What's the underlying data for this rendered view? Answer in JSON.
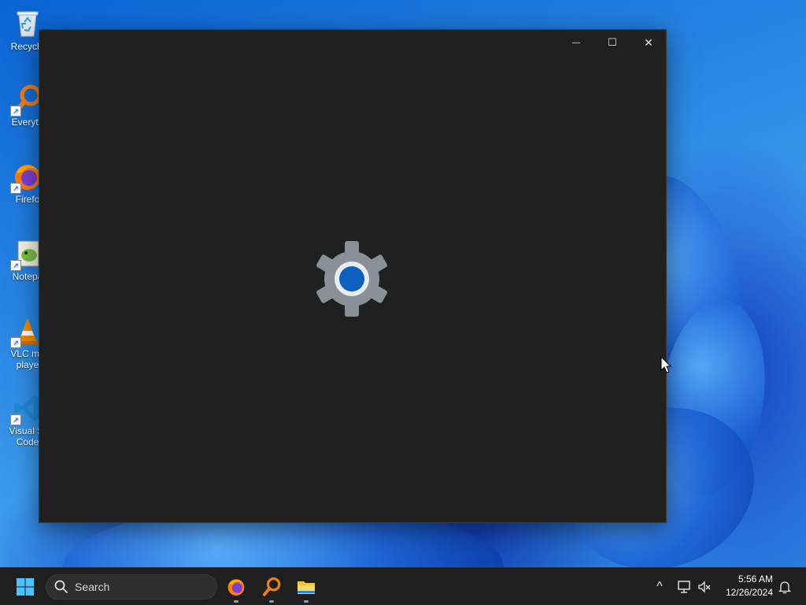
{
  "desktop": {
    "icons": [
      {
        "label": "Recycle"
      },
      {
        "label": "Everyth"
      },
      {
        "label": "Firefo"
      },
      {
        "label": "Notepa"
      },
      {
        "label": "VLC me playe"
      },
      {
        "label": "Visual St Code"
      }
    ]
  },
  "settings_window": {
    "minimize_symbol": "—",
    "maximize_symbol": "☐",
    "close_symbol": "✕",
    "splash_icon": "settings-gear-icon"
  },
  "taskbar": {
    "search": {
      "placeholder": "Search"
    },
    "pinned_apps": [
      {
        "name": "firefox-icon"
      },
      {
        "name": "everything-search-icon"
      },
      {
        "name": "file-explorer-icon"
      }
    ],
    "tray": {
      "overflow_symbol": "^",
      "clock": {
        "time": "5:56 AM",
        "date": "12/26/2024"
      }
    }
  },
  "colors": {
    "window_bg": "#202020",
    "taskbar_bg": "#1f1f1f",
    "accent": "#0f5fbf"
  }
}
